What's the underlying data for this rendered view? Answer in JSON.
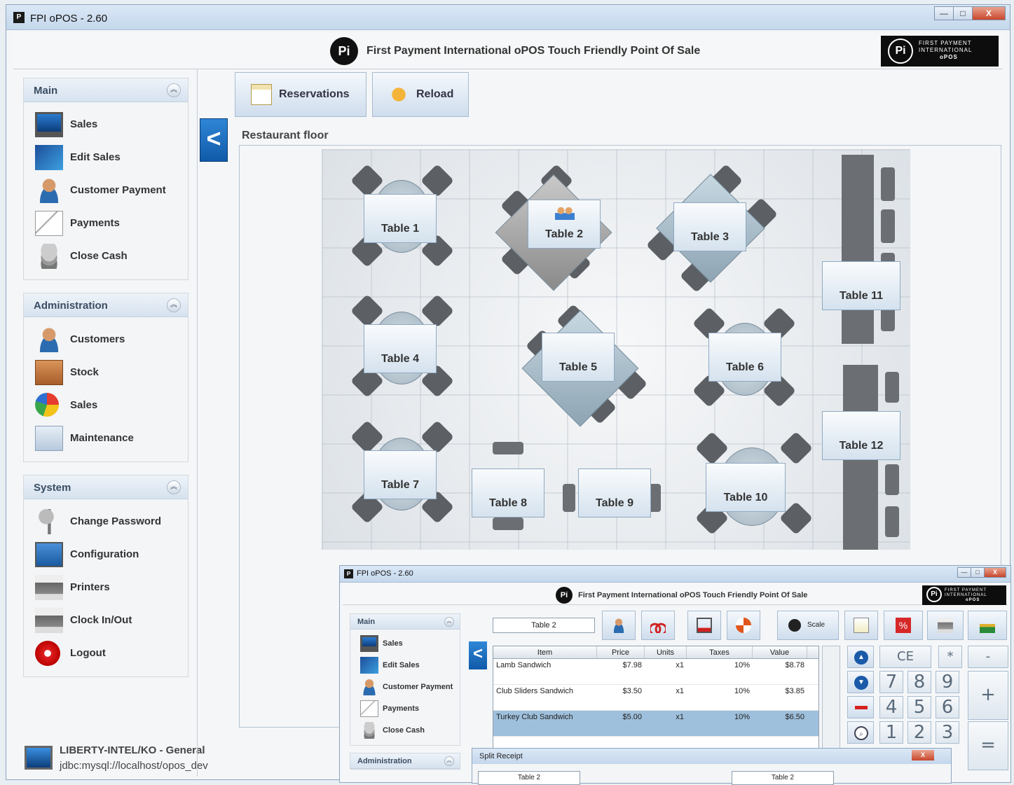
{
  "window": {
    "title": "FPI oPOS - 2.60",
    "minimize": "—",
    "maximize": "□",
    "close": "X"
  },
  "header": {
    "logo_text": "Pi",
    "tagline": "First Payment International oPOS   Touch Friendly Point Of Sale",
    "brand_line1": "FIRST PAYMENT",
    "brand_line2": "INTERNATIONAL",
    "brand_line3": "oPOS"
  },
  "sidebar": {
    "main": {
      "title": "Main",
      "items": [
        {
          "label": "Sales",
          "icon": "monitor-icon"
        },
        {
          "label": "Edit Sales",
          "icon": "edit-sales-icon"
        },
        {
          "label": "Customer Payment",
          "icon": "customer-payment-icon"
        },
        {
          "label": "Payments",
          "icon": "payments-icon"
        },
        {
          "label": "Close Cash",
          "icon": "close-cash-icon"
        }
      ]
    },
    "administration": {
      "title": "Administration",
      "items": [
        {
          "label": "Customers",
          "icon": "customer-icon"
        },
        {
          "label": "Stock",
          "icon": "stock-icon"
        },
        {
          "label": "Sales",
          "icon": "sales-chart-icon"
        },
        {
          "label": "Maintenance",
          "icon": "maintenance-icon"
        }
      ]
    },
    "system": {
      "title": "System",
      "items": [
        {
          "label": "Change Password",
          "icon": "keys-icon"
        },
        {
          "label": "Configuration",
          "icon": "configuration-icon"
        },
        {
          "label": "Printers",
          "icon": "printer-icon"
        },
        {
          "label": "Clock In/Out",
          "icon": "clock-printer-icon"
        },
        {
          "label": "Logout",
          "icon": "logout-icon"
        }
      ]
    }
  },
  "status": {
    "line1": "LIBERTY-INTEL/KO - General",
    "line2": "jdbc:mysql://localhost/opos_dev"
  },
  "toolbar": {
    "back": "<",
    "reservations": "Reservations",
    "reload": "Reload"
  },
  "floor": {
    "title": "Restaurant floor",
    "tables": [
      "Table 1",
      "Table 2",
      "Table 3",
      "Table 4",
      "Table 5",
      "Table 6",
      "Table 7",
      "Table 8",
      "Table 9",
      "Table 10",
      "Table 11",
      "Table 12"
    ],
    "occupied_table": "Table 2"
  },
  "inset": {
    "title": "FPI oPOS - 2.60",
    "tagline": "First Payment International oPOS   Touch Friendly Point Of Sale",
    "main_title": "Main",
    "main_items": [
      "Sales",
      "Edit Sales",
      "Customer Payment",
      "Payments",
      "Close Cash"
    ],
    "admin_title": "Administration",
    "table_field": "Table 2",
    "scale_label": "Scale",
    "ticket": {
      "headers": [
        "Item",
        "Price",
        "Units",
        "Taxes",
        "Value"
      ],
      "rows": [
        {
          "item": "Lamb  Sandwich",
          "price": "$7.98",
          "units": "x1",
          "taxes": "10%",
          "value": "$8.78"
        },
        {
          "item": "Club Sliders  Sandwich",
          "price": "$3.50",
          "units": "x1",
          "taxes": "10%",
          "value": "$3.85"
        },
        {
          "item": "Turkey Club  Sandwich",
          "price": "$5.00",
          "units": "x1",
          "taxes": "10%",
          "value": "$6.50"
        }
      ]
    },
    "keypad": {
      "ce": "CE",
      "mul": "*",
      "minus": "-",
      "plus": "+",
      "eq": "=",
      "digits": [
        "7",
        "8",
        "9",
        "4",
        "5",
        "6",
        "1",
        "2",
        "3"
      ]
    },
    "split": {
      "title": "Split Receipt",
      "left_table": "Table 2",
      "right_table": "Table 2",
      "close": "X"
    }
  }
}
